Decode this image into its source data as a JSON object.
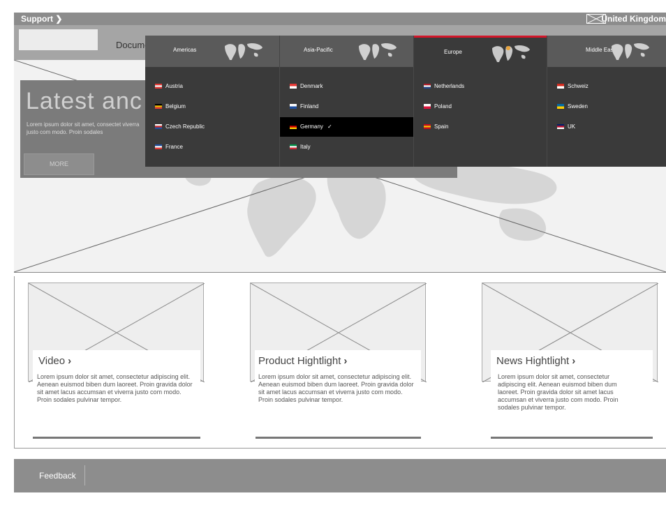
{
  "topbar": {
    "support_label": "Support",
    "country_label": "United Kingdom"
  },
  "header": {
    "documents_label": "Docume"
  },
  "hero": {
    "title": "Latest anc",
    "text": "Lorem ipsum dolor sit amet, consectet viverra justo com modo. Proin sodales",
    "more_label": "MORE"
  },
  "region_menu": {
    "tabs": [
      {
        "label": "Americas",
        "active": false
      },
      {
        "label": "Asia-Pacific",
        "active": false
      },
      {
        "label": "Europe",
        "active": true
      },
      {
        "label": "Middle East",
        "active": false
      }
    ],
    "columns": [
      [
        {
          "label": "Austria",
          "flag_colors": [
            "#e53935",
            "#ffffff",
            "#e53935"
          ]
        },
        {
          "label": "Belgium",
          "flag_colors": [
            "#000000",
            "#f5c400",
            "#e53935"
          ]
        },
        {
          "label": "Czech Republic",
          "flag_colors": [
            "#ffffff",
            "#d32f2f",
            "#1e4fa0"
          ]
        },
        {
          "label": "France",
          "flag_colors": [
            "#1e4fa0",
            "#ffffff",
            "#e53935"
          ]
        }
      ],
      [
        {
          "label": "Denmark",
          "flag_colors": [
            "#e53935",
            "#ffffff"
          ]
        },
        {
          "label": "Finland",
          "flag_colors": [
            "#ffffff",
            "#1e4fa0"
          ]
        },
        {
          "label": "Germany",
          "flag_colors": [
            "#000000",
            "#dd0000",
            "#ffce00"
          ],
          "selected": true
        },
        {
          "label": "Italy",
          "flag_colors": [
            "#009246",
            "#ffffff",
            "#ce2b37"
          ]
        }
      ],
      [
        {
          "label": "Netherlands",
          "flag_colors": [
            "#ae1c28",
            "#ffffff",
            "#21468b"
          ]
        },
        {
          "label": "Poland",
          "flag_colors": [
            "#ffffff",
            "#dc143c"
          ]
        },
        {
          "label": "Spain",
          "flag_colors": [
            "#c60b1e",
            "#ffc400",
            "#c60b1e"
          ]
        }
      ],
      [
        {
          "label": "Schweiz",
          "flag_colors": [
            "#d52b1e",
            "#ffffff"
          ]
        },
        {
          "label": "Sweden",
          "flag_colors": [
            "#006aa7",
            "#fecc00"
          ]
        },
        {
          "label": "UK",
          "flag_colors": [
            "#012169",
            "#c8102e",
            "#ffffff"
          ]
        }
      ]
    ],
    "selected_check": "✓",
    "accent_color": "#d3162a"
  },
  "cards": [
    {
      "title": "Video",
      "arrow": "›",
      "body": "Lorem ipsum dolor sit amet, consectetur adipiscing elit. Aenean euismod biben dum laoreet. Proin gravida dolor sit amet lacus accumsan et viverra justo com modo. Proin sodales pulvinar tempor."
    },
    {
      "title": "Product Hightlight",
      "arrow": "›",
      "body": "Lorem ipsum dolor sit amet, consectetur adipiscing elit. Aenean euismod biben dum laoreet. Proin gravida dolor sit amet lacus accumsan et viverra justo com modo. Proin sodales pulvinar tempor."
    },
    {
      "title": "News Hightlight",
      "arrow": "›",
      "body": "Lorem ipsum dolor sit amet, consectetur adipiscing elit. Aenean euismod biben dum laoreet. Proin gravida dolor sit amet lacus accumsan et viverra justo com modo. Proin sodales pulvinar tempor."
    }
  ],
  "footer": {
    "feedback_label": "Feedback"
  }
}
